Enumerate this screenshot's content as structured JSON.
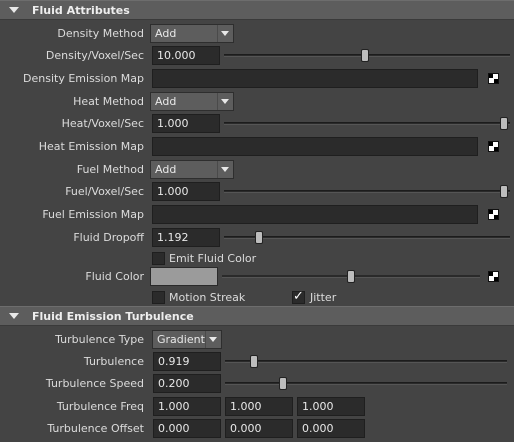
{
  "fluid_attributes": {
    "header": "Fluid Attributes",
    "density_method": {
      "label": "Density Method",
      "value": "Add"
    },
    "density_voxel": {
      "label": "Density/Voxel/Sec",
      "value": "10.000",
      "slider_fraction": 0.5
    },
    "density_map": {
      "label": "Density Emission Map",
      "icon": "checker-map-icon"
    },
    "heat_method": {
      "label": "Heat Method",
      "value": "Add"
    },
    "heat_voxel": {
      "label": "Heat/Voxel/Sec",
      "value": "1.000",
      "slider_fraction": 1.0
    },
    "heat_map": {
      "label": "Heat Emission Map",
      "icon": "checker-map-icon"
    },
    "fuel_method": {
      "label": "Fuel Method",
      "value": "Add"
    },
    "fuel_voxel": {
      "label": "Fuel/Voxel/Sec",
      "value": "1.000",
      "slider_fraction": 1.0
    },
    "fuel_map": {
      "label": "Fuel Emission Map",
      "icon": "checker-map-icon"
    },
    "fluid_dropoff": {
      "label": "Fluid Dropoff",
      "value": "1.192",
      "slider_fraction": 0.12
    },
    "emit_fluid_color": {
      "label": "Emit Fluid Color",
      "checked": false
    },
    "fluid_color": {
      "label": "Fluid Color",
      "swatch": "#9b9b9b",
      "slider_fraction": 0.5
    },
    "motion_streak": {
      "label": "Motion Streak",
      "checked": false
    },
    "jitter": {
      "label": "Jitter",
      "checked": true
    }
  },
  "fluid_emission_turbulence": {
    "header": "Fluid Emission Turbulence",
    "turbulence_type": {
      "label": "Turbulence Type",
      "value": "Gradient"
    },
    "turbulence": {
      "label": "Turbulence",
      "value": "0.919",
      "slider_fraction": 0.1
    },
    "turbulence_speed": {
      "label": "Turbulence Speed",
      "value": "0.200",
      "slider_fraction": 0.2
    },
    "turbulence_freq": {
      "label": "Turbulence Freq",
      "values": [
        "1.000",
        "1.000",
        "1.000"
      ]
    },
    "turbulence_offset": {
      "label": "Turbulence Offset",
      "values": [
        "0.000",
        "0.000",
        "0.000"
      ]
    }
  },
  "colors": {
    "panel_bg": "#444444",
    "header_bg": "#5d5d5d",
    "field_bg": "#2b2b2b"
  }
}
